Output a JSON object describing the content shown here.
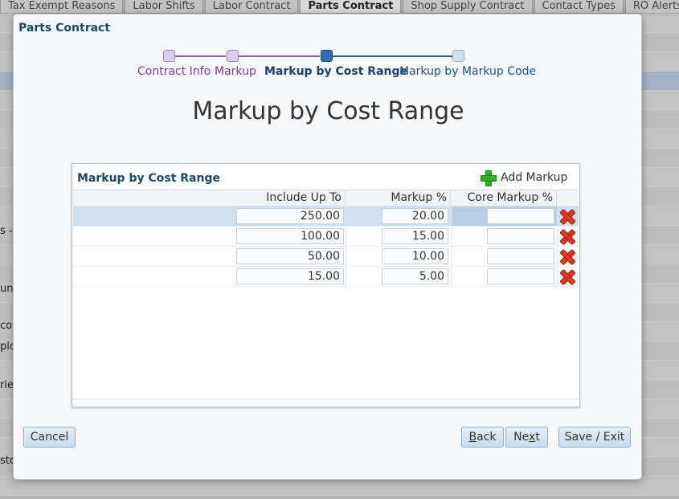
{
  "background": {
    "tabs": [
      {
        "label": "Tax Exempt Reasons",
        "active": false
      },
      {
        "label": "Labor Shifts",
        "active": false
      },
      {
        "label": "Labor Contract",
        "active": false
      },
      {
        "label": "Parts Contract",
        "active": true
      },
      {
        "label": "Shop Supply Contract",
        "active": false
      },
      {
        "label": "Contact Types",
        "active": false
      },
      {
        "label": "RO Alerts",
        "active": false
      }
    ],
    "fragments": [
      "s -",
      "un",
      "co",
      "plo",
      "rie",
      "sto"
    ]
  },
  "dialog": {
    "title": "Parts Contract",
    "heading": "Markup by Cost Range"
  },
  "train": {
    "steps": [
      {
        "label": "Contract Info",
        "state": "visited"
      },
      {
        "label": "Markup",
        "state": "visited"
      },
      {
        "label": "Markup by Cost Range",
        "state": "current"
      },
      {
        "label": "Markup by Markup Code",
        "state": "future"
      }
    ]
  },
  "panel": {
    "title": "Markup by Cost Range",
    "add_label": "Add Markup",
    "columns": [
      "Include Up To",
      "Markup %",
      "Core Markup %"
    ],
    "rows": [
      {
        "include_up_to": "250.00",
        "markup_pct": "20.00",
        "core_markup_pct": "",
        "selected": true
      },
      {
        "include_up_to": "100.00",
        "markup_pct": "15.00",
        "core_markup_pct": "",
        "selected": false
      },
      {
        "include_up_to": "50.00",
        "markup_pct": "10.00",
        "core_markup_pct": "",
        "selected": false
      },
      {
        "include_up_to": "15.00",
        "markup_pct": "5.00",
        "core_markup_pct": "",
        "selected": false
      }
    ]
  },
  "buttons": {
    "cancel": "Cancel",
    "back_first": "B",
    "back_rest": "ack",
    "next_first": "Ne",
    "next_underlined": "x",
    "next_rest": "t",
    "save_exit": "Save / Exit"
  },
  "colors": {
    "accent": "#1c4a69",
    "delete": "#e0381e",
    "add": "#2fb12a",
    "selected_row": "#cfdff0"
  }
}
